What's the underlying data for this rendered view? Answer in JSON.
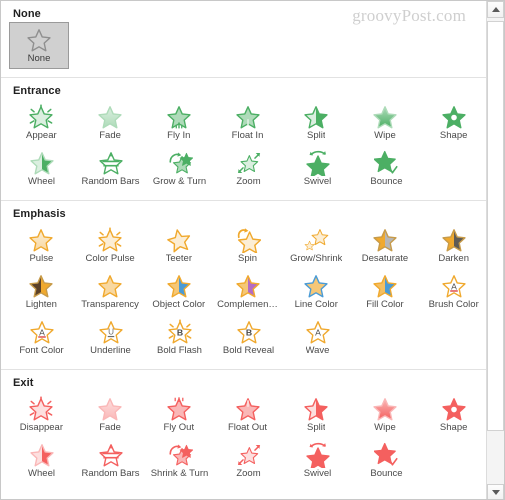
{
  "watermark": "groovyPost.com",
  "colors": {
    "entrance": "#4CAF64",
    "emphasis": "#F0A92E",
    "exit": "#F4605F",
    "none_outline": "#8f8f8f",
    "panel_bg": "#ffffff",
    "selected_bg": "#d0d0d0"
  },
  "sections": [
    {
      "title": "None",
      "kind": "none",
      "rows": [
        [
          {
            "label": "None",
            "icon": "star-outline-icon",
            "selected": true
          }
        ]
      ]
    },
    {
      "title": "Entrance",
      "kind": "entrance",
      "rows": [
        [
          {
            "label": "Appear",
            "icon": "star-burst-icon"
          },
          {
            "label": "Fade",
            "icon": "star-fade-icon"
          },
          {
            "label": "Fly In",
            "icon": "star-fly-in-icon"
          },
          {
            "label": "Float In",
            "icon": "star-float-in-icon"
          },
          {
            "label": "Split",
            "icon": "star-split-icon"
          },
          {
            "label": "Wipe",
            "icon": "star-wipe-icon"
          },
          {
            "label": "Shape",
            "icon": "star-shape-icon"
          }
        ],
        [
          {
            "label": "Wheel",
            "icon": "star-wheel-icon"
          },
          {
            "label": "Random Bars",
            "icon": "star-random-bars-icon"
          },
          {
            "label": "Grow & Turn",
            "icon": "star-grow-turn-icon"
          },
          {
            "label": "Zoom",
            "icon": "star-zoom-icon"
          },
          {
            "label": "Swivel",
            "icon": "star-swivel-icon"
          },
          {
            "label": "Bounce",
            "icon": "star-bounce-icon"
          }
        ]
      ]
    },
    {
      "title": "Emphasis",
      "kind": "emphasis",
      "rows": [
        [
          {
            "label": "Pulse",
            "icon": "star-pulse-icon"
          },
          {
            "label": "Color Pulse",
            "icon": "star-color-pulse-icon"
          },
          {
            "label": "Teeter",
            "icon": "star-teeter-icon"
          },
          {
            "label": "Spin",
            "icon": "star-spin-icon"
          },
          {
            "label": "Grow/Shrink",
            "icon": "star-grow-shrink-icon"
          },
          {
            "label": "Desaturate",
            "icon": "star-desaturate-icon"
          },
          {
            "label": "Darken",
            "icon": "star-darken-icon"
          }
        ],
        [
          {
            "label": "Lighten",
            "icon": "star-lighten-icon"
          },
          {
            "label": "Transparency",
            "icon": "star-transparency-icon"
          },
          {
            "label": "Object Color",
            "icon": "star-object-color-icon"
          },
          {
            "label": "Complemen…",
            "icon": "star-complementary-color-icon"
          },
          {
            "label": "Line Color",
            "icon": "star-line-color-icon"
          },
          {
            "label": "Fill Color",
            "icon": "star-fill-color-icon"
          },
          {
            "label": "Brush Color",
            "icon": "star-brush-color-icon"
          }
        ],
        [
          {
            "label": "Font Color",
            "icon": "star-font-color-icon"
          },
          {
            "label": "Underline",
            "icon": "star-underline-icon"
          },
          {
            "label": "Bold Flash",
            "icon": "star-bold-flash-icon"
          },
          {
            "label": "Bold Reveal",
            "icon": "star-bold-reveal-icon"
          },
          {
            "label": "Wave",
            "icon": "star-wave-icon"
          }
        ]
      ]
    },
    {
      "title": "Exit",
      "kind": "exit",
      "rows": [
        [
          {
            "label": "Disappear",
            "icon": "star-burst-icon"
          },
          {
            "label": "Fade",
            "icon": "star-fade-icon"
          },
          {
            "label": "Fly Out",
            "icon": "star-fly-out-icon"
          },
          {
            "label": "Float Out",
            "icon": "star-float-out-icon"
          },
          {
            "label": "Split",
            "icon": "star-split-icon"
          },
          {
            "label": "Wipe",
            "icon": "star-wipe-icon"
          },
          {
            "label": "Shape",
            "icon": "star-shape-icon"
          }
        ],
        [
          {
            "label": "Wheel",
            "icon": "star-wheel-icon"
          },
          {
            "label": "Random Bars",
            "icon": "star-random-bars-icon"
          },
          {
            "label": "Shrink & Turn",
            "icon": "star-grow-turn-icon"
          },
          {
            "label": "Zoom",
            "icon": "star-zoom-icon"
          },
          {
            "label": "Swivel",
            "icon": "star-swivel-icon"
          },
          {
            "label": "Bounce",
            "icon": "star-bounce-icon"
          }
        ]
      ]
    }
  ],
  "scrollbar": {
    "up_arrow": "scroll-up-arrow-icon",
    "down_arrow": "scroll-down-arrow-icon",
    "thumb": "scroll-thumb"
  }
}
